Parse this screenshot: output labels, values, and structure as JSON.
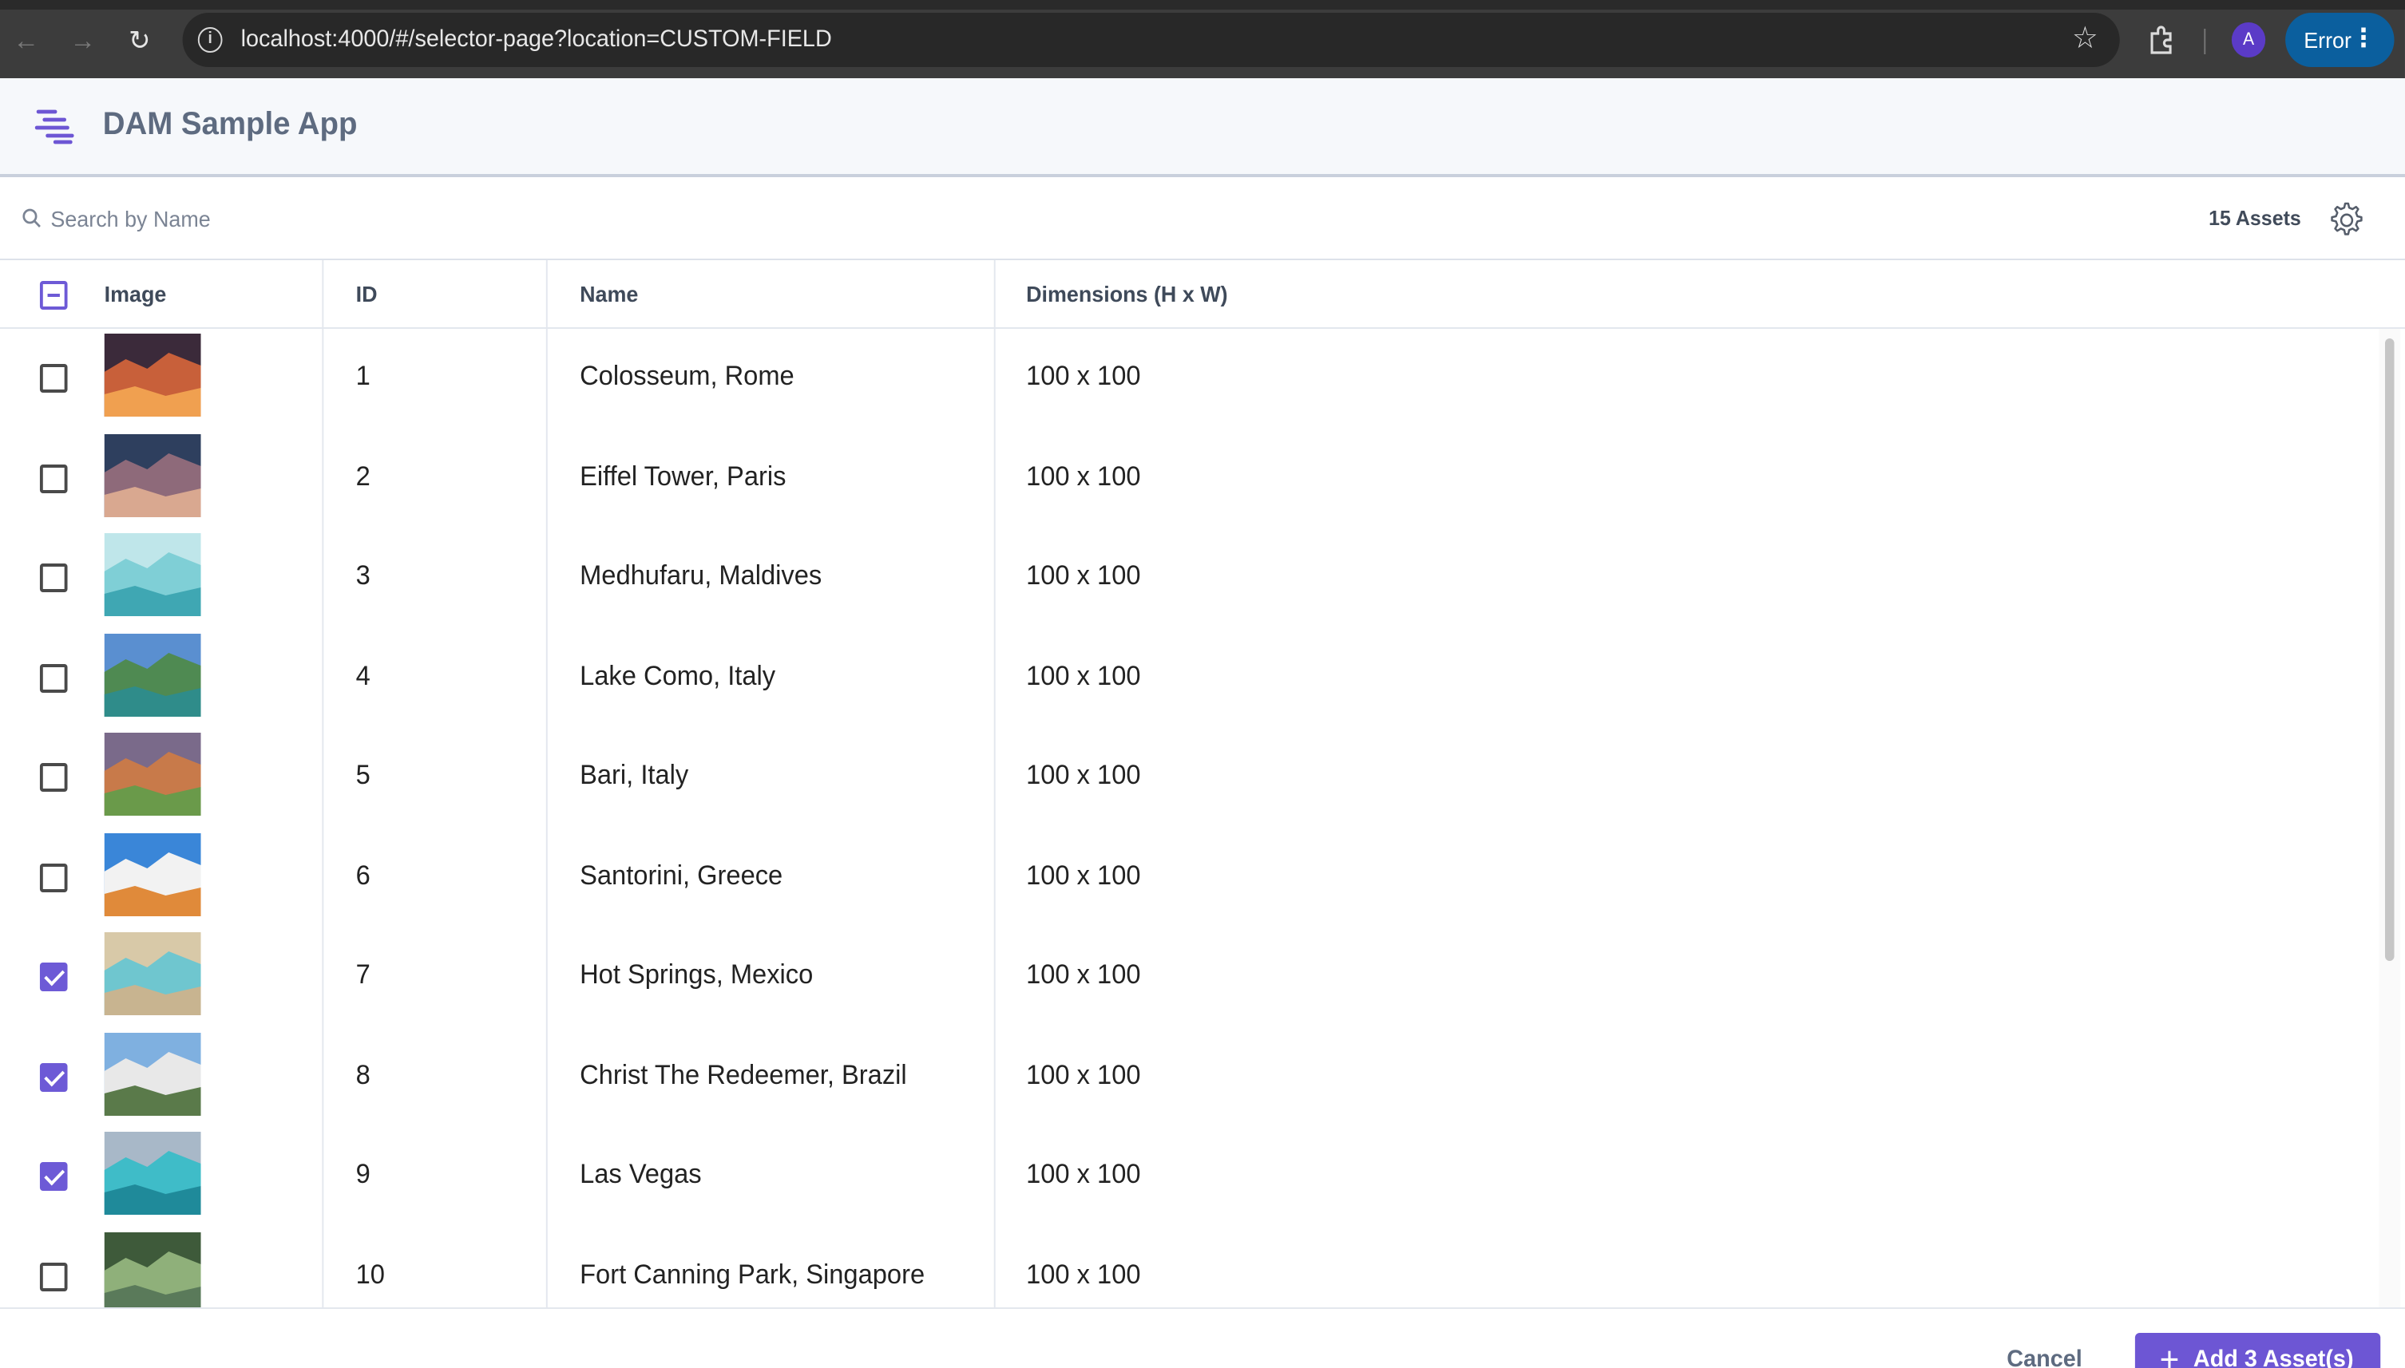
{
  "browser": {
    "url": "localhost:4000/#/selector-page?location=CUSTOM-FIELD",
    "profile_initial": "A",
    "error_label": "Error"
  },
  "app": {
    "title": "DAM Sample App"
  },
  "toolbar": {
    "search_placeholder": "Search by Name",
    "asset_count": "15 Assets"
  },
  "table": {
    "columns": [
      "Image",
      "ID",
      "Name",
      "Dimensions (H x W)"
    ],
    "select_all_state": "indeterminate",
    "rows": [
      {
        "id": "1",
        "name": "Colosseum, Rome",
        "dimensions": "100 x 100",
        "checked": false,
        "thumb": [
          "#3b2a3a",
          "#c8603a",
          "#f0a050"
        ]
      },
      {
        "id": "2",
        "name": "Eiffel Tower, Paris",
        "dimensions": "100 x 100",
        "checked": false,
        "thumb": [
          "#2e3f5e",
          "#8e6a7a",
          "#d9a890"
        ]
      },
      {
        "id": "3",
        "name": "Medhufaru, Maldives",
        "dimensions": "100 x 100",
        "checked": false,
        "thumb": [
          "#bfe6ea",
          "#7fcfd6",
          "#3fa7b3"
        ]
      },
      {
        "id": "4",
        "name": "Lake Como, Italy",
        "dimensions": "100 x 100",
        "checked": false,
        "thumb": [
          "#5a8fd0",
          "#4f8a52",
          "#2f8c8a"
        ]
      },
      {
        "id": "5",
        "name": "Bari, Italy",
        "dimensions": "100 x 100",
        "checked": false,
        "thumb": [
          "#7a6a8a",
          "#c87a4a",
          "#6a9a4a"
        ]
      },
      {
        "id": "6",
        "name": "Santorini, Greece",
        "dimensions": "100 x 100",
        "checked": false,
        "thumb": [
          "#3a86d8",
          "#f2f2f2",
          "#e08a3a"
        ]
      },
      {
        "id": "7",
        "name": "Hot Springs, Mexico",
        "dimensions": "100 x 100",
        "checked": true,
        "thumb": [
          "#d8c9a8",
          "#6fc6cf",
          "#c8b490"
        ]
      },
      {
        "id": "8",
        "name": "Christ The Redeemer, Brazil",
        "dimensions": "100 x 100",
        "checked": true,
        "thumb": [
          "#7fb0e0",
          "#e8e8e8",
          "#5a7a4a"
        ]
      },
      {
        "id": "9",
        "name": "Las Vegas",
        "dimensions": "100 x 100",
        "checked": true,
        "thumb": [
          "#a8b8c8",
          "#3fbcc8",
          "#1f8a9a"
        ]
      },
      {
        "id": "10",
        "name": "Fort Canning Park, Singapore",
        "dimensions": "100 x 100",
        "checked": false,
        "thumb": [
          "#3e5a3a",
          "#8fb07a",
          "#5a7a5a"
        ]
      }
    ]
  },
  "footer": {
    "cancel_label": "Cancel",
    "add_label": "Add 3 Asset(s)"
  },
  "colors": {
    "accent": "#6d56d4",
    "header_bg": "#f6f8fb",
    "error_chip": "#0b5f9e"
  }
}
